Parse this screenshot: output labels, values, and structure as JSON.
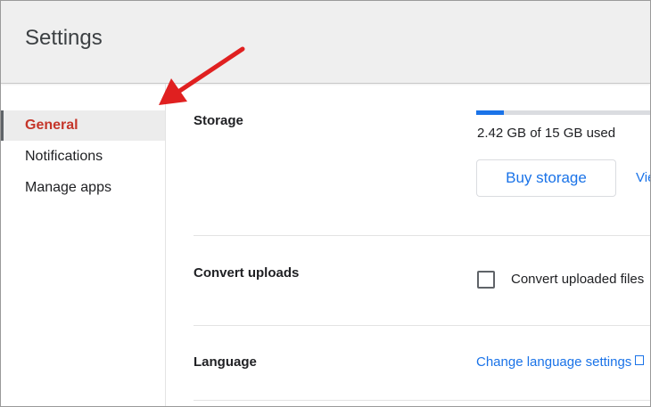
{
  "header": {
    "title": "Settings"
  },
  "sidebar": {
    "items": [
      {
        "label": "General",
        "active": true
      },
      {
        "label": "Notifications",
        "active": false
      },
      {
        "label": "Manage apps",
        "active": false
      }
    ]
  },
  "storage": {
    "label": "Storage",
    "usage_text": "2.42 GB of 15 GB used",
    "used_fraction": 0.161,
    "buy_label": "Buy storage",
    "view_link": "Vie"
  },
  "convert": {
    "label": "Convert uploads",
    "checkbox_label": "Convert uploaded files",
    "checked": false
  },
  "language": {
    "label": "Language",
    "link": "Change language settings"
  },
  "colors": {
    "accent": "#1a73e8",
    "active_nav": "#c5362a",
    "annotation_arrow": "#e02020"
  }
}
